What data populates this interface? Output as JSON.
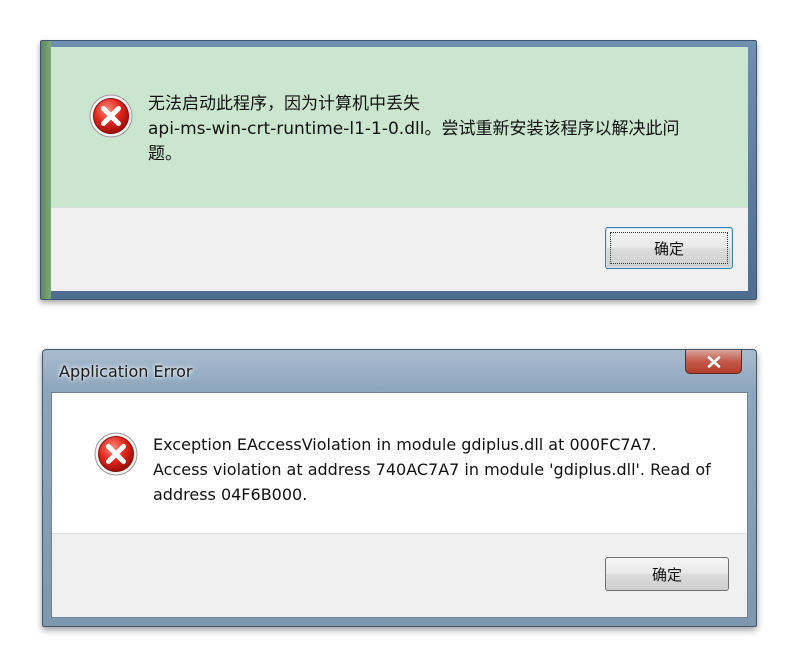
{
  "dialog1": {
    "message_lines": [
      "无法启动此程序，因为计算机中丢失",
      "api-ms-win-crt-runtime-l1-1-0.dll。尝试重新安装该程序以解决此问",
      "题。"
    ],
    "ok_label": "确定",
    "icon": "error-icon",
    "colors": {
      "content_bg": "#cbe6cf",
      "footer_bg": "#f0f0f0"
    }
  },
  "dialog2": {
    "title": "Application Error",
    "close_label": "x",
    "message_lines": [
      "Exception EAccessViolation in module gdiplus.dll at 000FC7A7.",
      "Access violation at address 740AC7A7 in module 'gdiplus.dll'. Read of",
      "address 04F6B000."
    ],
    "ok_label": "确定",
    "icon": "error-icon",
    "colors": {
      "content_bg": "#ffffff",
      "footer_bg": "#f0f0f0",
      "close_button": "#c4584a"
    }
  }
}
